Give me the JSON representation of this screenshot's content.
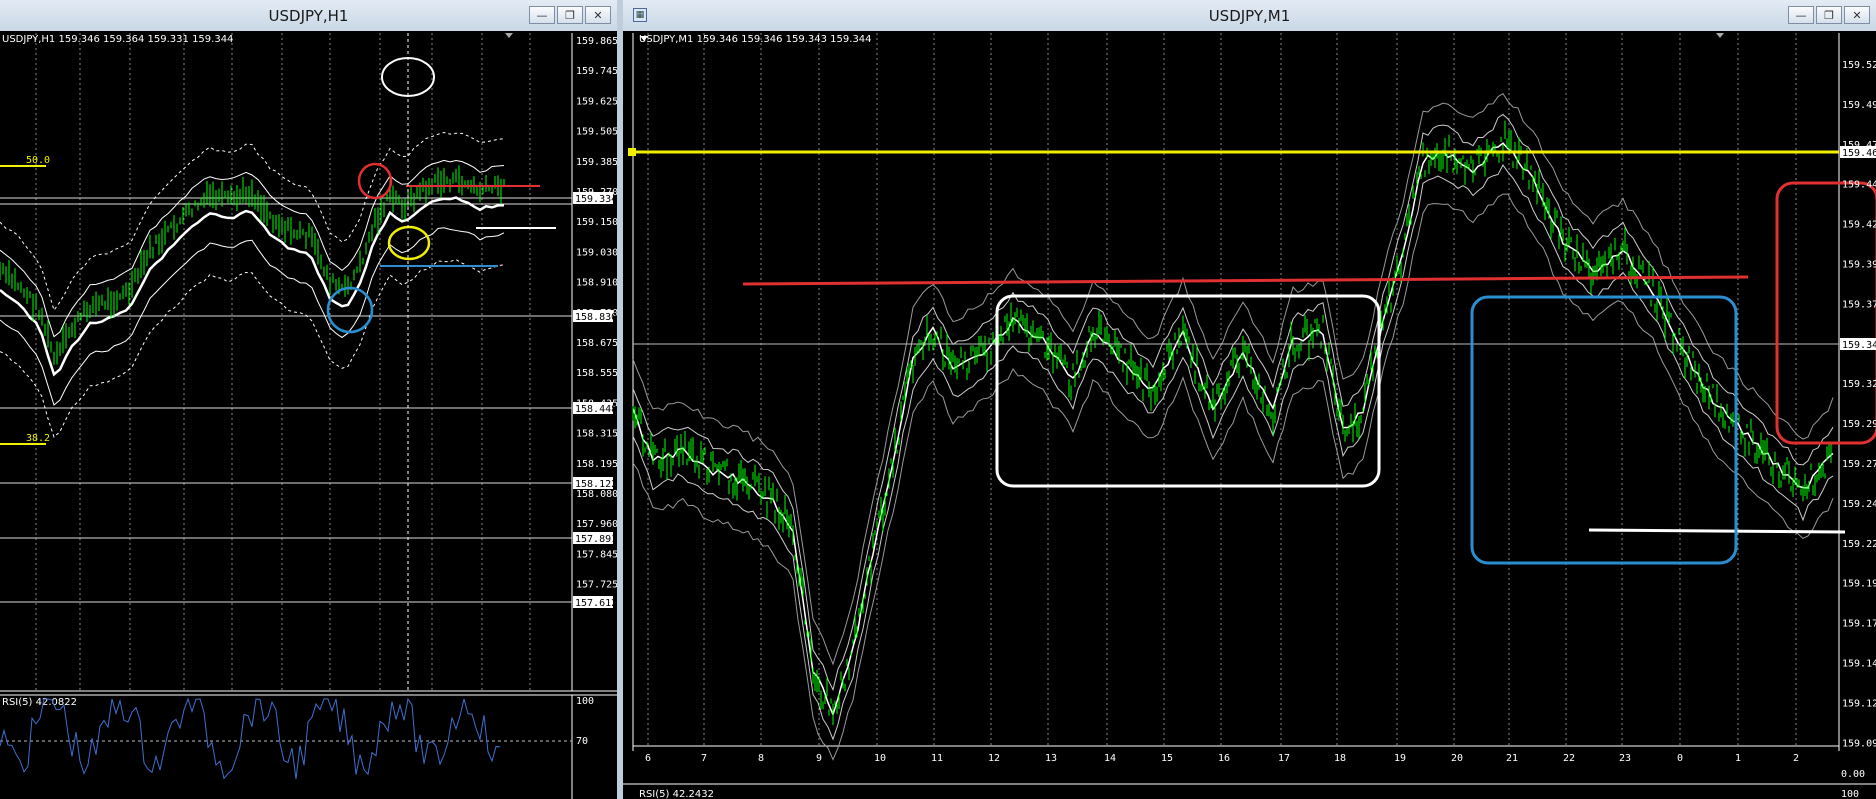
{
  "colors": {
    "background": "#000000",
    "candle": "#00ff00",
    "grid": "#ffffff",
    "red": "#e03030",
    "yellow": "#f0f000",
    "blue": "#2a8fd0",
    "white": "#ffffff",
    "rsi": "#3f6fd0"
  },
  "icons": {
    "minimize": "minimize-icon",
    "restore": "restore-icon",
    "close": "close-icon",
    "menu": "chart-system-icon",
    "dropdown": "triangle-down-icon"
  },
  "h1": {
    "title": "USDJPY,H1",
    "info": "USDJPY,H1  159.346 159.364 159.331 159.344",
    "prices": [
      "159.865",
      "159.745",
      "159.625",
      "159.505",
      "159.385",
      "159.270",
      "159.150",
      "159.030",
      "158.910",
      "158.790",
      "158.675",
      "158.555",
      "158.435",
      "158.315",
      "158.195",
      "158.080",
      "157.960",
      "157.845",
      "157.725"
    ],
    "boxed_prices": [
      "159.334",
      "158.830",
      "158.448",
      "158.122",
      "157.891",
      "157.612"
    ],
    "fib_50": "50.0",
    "fib_382": "38.2",
    "rsi_label": "RSI(5) 42.0822",
    "rsi_scale": [
      "100",
      "70"
    ]
  },
  "m1": {
    "title": "USDJPY,M1",
    "info": "USDJPY,M1  159.346 159.346 159.343 159.344",
    "prices": [
      "159.520",
      "159.495",
      "159.470",
      "159.445",
      "159.420",
      "159.395",
      "159.370",
      "159.345",
      "159.320",
      "159.295",
      "159.270",
      "159.245",
      "159.220",
      "159.195",
      "159.170",
      "159.145",
      "159.120",
      "159.095"
    ],
    "boxed_prices": [
      "159.467",
      "159.344"
    ],
    "time_labels": [
      "6",
      "7",
      "8",
      "9",
      "10",
      "11",
      "12",
      "13",
      "14",
      "15",
      "16",
      "17",
      "18",
      "19",
      "20",
      "21",
      "22",
      "23",
      "0",
      "1",
      "2"
    ],
    "rsi_label": "RSI(5) 42.2432",
    "rsi_scale": [
      "0.00",
      "100"
    ]
  }
}
